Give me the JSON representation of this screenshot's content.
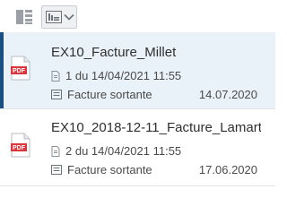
{
  "toolbar": {
    "icons": [
      "layout-toggle-icon",
      "card-view-icon",
      "chevron-down-icon"
    ]
  },
  "documents": [
    {
      "title": "EX10_Facture_Millet",
      "version_info": "1 du 14/04/2021 11:55",
      "type": "Facture sortante",
      "date": "14.07.2020",
      "selected": true
    },
    {
      "title": "EX10_2018-12-11_Facture_Lamart...",
      "version_info": "2 du 14/04/2021 11:55",
      "type": "Facture sortante",
      "date": "17.06.2020",
      "selected": false
    }
  ],
  "colors": {
    "accent": "#1a4f86",
    "selected_bg": "#e9f1f9",
    "pdf_red": "#d9363e"
  }
}
